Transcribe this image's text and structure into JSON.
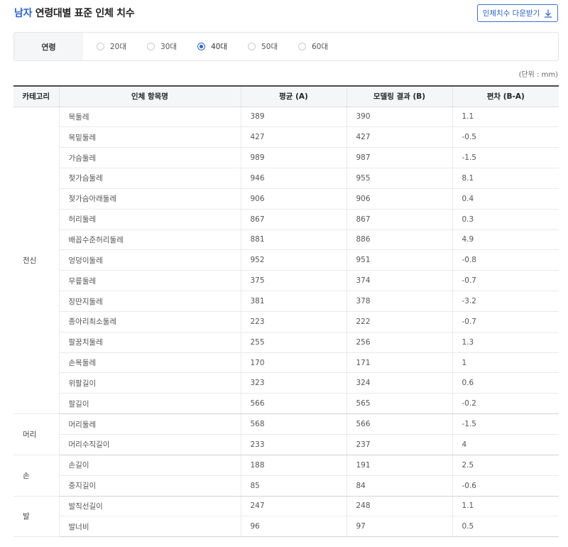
{
  "header": {
    "title_accent": "남자",
    "title_rest": " 연령대별 표준 인체 치수",
    "download_label": "인체치수 다운받기"
  },
  "filter": {
    "label": "연령",
    "options": [
      "20대",
      "30대",
      "40대",
      "50대",
      "60대"
    ],
    "selected": "40대"
  },
  "unit_label": "(단위 : mm)",
  "table": {
    "columns": [
      "카테고리",
      "인체 항목명",
      "평균 (A)",
      "모델링 결과 (B)",
      "편차 (B-A)"
    ],
    "groups": [
      {
        "category": "전신",
        "rows": [
          {
            "item": "목둘레",
            "avg": "389",
            "model": "390",
            "diff": "1.1"
          },
          {
            "item": "목밑둘레",
            "avg": "427",
            "model": "427",
            "diff": "-0.5"
          },
          {
            "item": "가슴둘레",
            "avg": "989",
            "model": "987",
            "diff": "-1.5"
          },
          {
            "item": "젖가슴둘레",
            "avg": "946",
            "model": "955",
            "diff": "8.1"
          },
          {
            "item": "젖가슴아래둘레",
            "avg": "906",
            "model": "906",
            "diff": "0.4"
          },
          {
            "item": "허리둘레",
            "avg": "867",
            "model": "867",
            "diff": "0.3"
          },
          {
            "item": "배꼽수준허리둘레",
            "avg": "881",
            "model": "886",
            "diff": "4.9"
          },
          {
            "item": "엉덩이둘레",
            "avg": "952",
            "model": "951",
            "diff": "-0.8"
          },
          {
            "item": "무릎둘레",
            "avg": "375",
            "model": "374",
            "diff": "-0.7"
          },
          {
            "item": "장딴지둘레",
            "avg": "381",
            "model": "378",
            "diff": "-3.2"
          },
          {
            "item": "종아리최소둘레",
            "avg": "223",
            "model": "222",
            "diff": "-0.7"
          },
          {
            "item": "팔꿈치둘레",
            "avg": "255",
            "model": "256",
            "diff": "1.3"
          },
          {
            "item": "손목둘레",
            "avg": "170",
            "model": "171",
            "diff": "1"
          },
          {
            "item": "위팔길이",
            "avg": "323",
            "model": "324",
            "diff": "0.6"
          },
          {
            "item": "팔길이",
            "avg": "566",
            "model": "565",
            "diff": "-0.2"
          }
        ]
      },
      {
        "category": "머리",
        "rows": [
          {
            "item": "머리둘레",
            "avg": "568",
            "model": "566",
            "diff": "-1.5"
          },
          {
            "item": "머리수직길이",
            "avg": "233",
            "model": "237",
            "diff": "4"
          }
        ]
      },
      {
        "category": "손",
        "rows": [
          {
            "item": "손길이",
            "avg": "188",
            "model": "191",
            "diff": "2.5"
          },
          {
            "item": "중지길이",
            "avg": "85",
            "model": "84",
            "diff": "-0.6"
          }
        ]
      },
      {
        "category": "발",
        "rows": [
          {
            "item": "발직선길이",
            "avg": "247",
            "model": "248",
            "diff": "1.1"
          },
          {
            "item": "발너비",
            "avg": "96",
            "model": "97",
            "diff": "0.5"
          }
        ]
      }
    ]
  },
  "icons": {
    "download": "download-icon",
    "radio": "radio-icon"
  },
  "colors": {
    "accent": "#2a64d6"
  }
}
